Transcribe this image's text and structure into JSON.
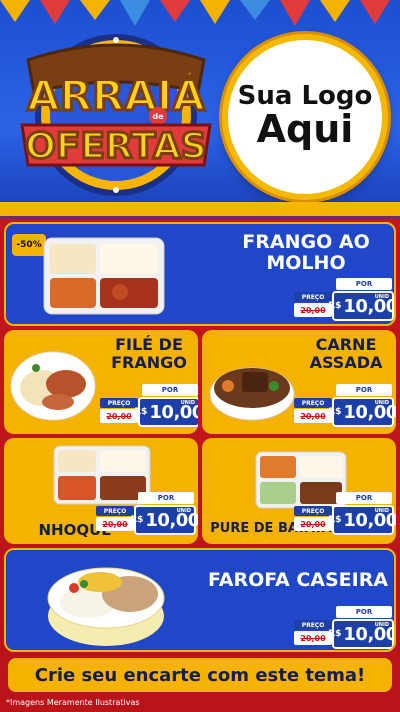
{
  "header": {
    "logo_line1": "Sua Logo",
    "logo_line2": "Aqui",
    "badge_word1": "ARRAIÁ",
    "badge_de": "de",
    "badge_word2": "OFERTAS"
  },
  "products": [
    {
      "name_line1": "FRANGO AO",
      "name_line2": "MOLHO",
      "badge": "-50%",
      "por": "POR",
      "preco": "PREÇO",
      "old": "20,00",
      "old_prefix": "R$",
      "currency": "R$",
      "price": "10,00",
      "unid": "UNID"
    },
    {
      "name_line1": "FILÉ DE",
      "name_line2": "FRANGO",
      "por": "POR",
      "preco": "PREÇO",
      "old": "20,00",
      "old_prefix": "R$",
      "currency": "R$",
      "price": "10,00",
      "unid": "UNID"
    },
    {
      "name_line1": "CARNE",
      "name_line2": "ASSADA",
      "por": "POR",
      "preco": "PREÇO",
      "old": "20,00",
      "old_prefix": "R$",
      "currency": "R$",
      "price": "10,00",
      "unid": "UNID"
    },
    {
      "name_line1": "NHOQUE",
      "por": "POR",
      "preco": "PREÇO",
      "old": "20,00",
      "old_prefix": "R$",
      "currency": "R$",
      "price": "10,00",
      "unid": "UNID"
    },
    {
      "name_line1": "PURE DE BATATA",
      "por": "POR",
      "preco": "PREÇO",
      "old": "20,00",
      "old_prefix": "R$",
      "currency": "R$",
      "price": "10,00",
      "unid": "UNID"
    },
    {
      "name_line1": "FAROFA CASEIRA",
      "por": "POR",
      "preco": "PREÇO",
      "old": "20,00",
      "old_prefix": "R$",
      "currency": "R$",
      "price": "10,00",
      "unid": "UNID"
    }
  ],
  "cta": "Crie seu encarte com este tema!",
  "footnote": "*Imagens Meramente Ilustrativas",
  "colors": {
    "blue": "#1f47c8",
    "yellow": "#f5b200",
    "red": "#c2171d",
    "navy": "#131e4a"
  }
}
